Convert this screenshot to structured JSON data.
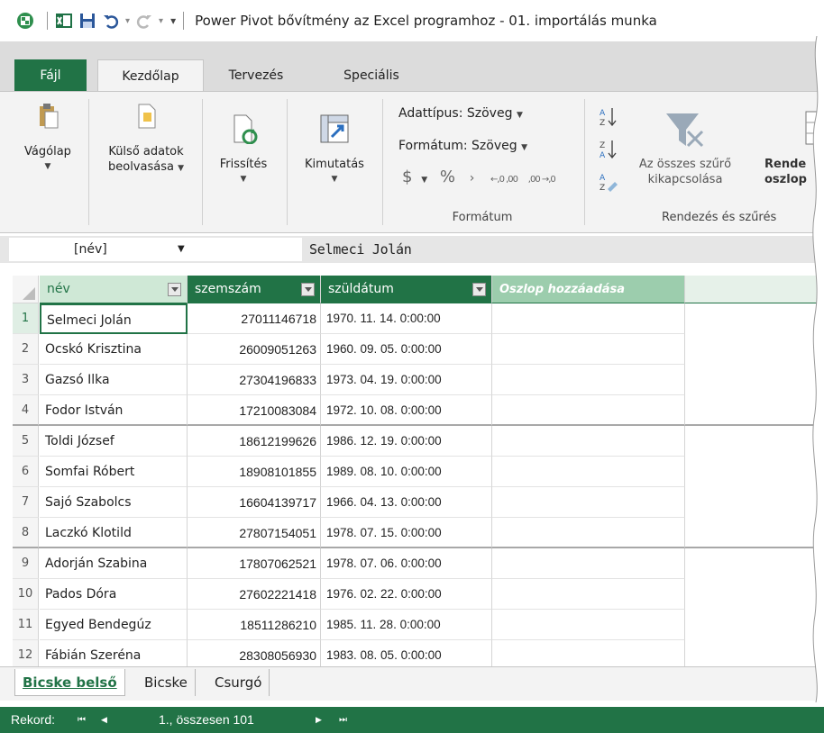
{
  "window": {
    "title": "Power Pivot bővítmény az Excel programhoz - 01. importálás munka"
  },
  "tabs": [
    {
      "label": "Fájl"
    },
    {
      "label": "Kezdőlap"
    },
    {
      "label": "Tervezés"
    },
    {
      "label": "Speciális"
    }
  ],
  "ribbon": {
    "clipboard": {
      "label": "Vágólap"
    },
    "external": {
      "line1": "Külső adatok",
      "line2": "beolvasása"
    },
    "refresh": {
      "label": "Frissítés"
    },
    "pivot": {
      "label": "Kimutatás"
    },
    "format": {
      "datatype": "Adattípus: Szöveg",
      "format": "Formátum: Szöveg",
      "currency": "$",
      "percent": "%",
      "comma": "›",
      "dec_inc": "←,0 ,00",
      "dec_dec": ",00 →,0",
      "group_label": "Formátum"
    },
    "sort": {
      "clear_line1": "Az összes szűrő",
      "clear_line2": "kikapcsolása",
      "sortcol_line1": "Rende",
      "sortcol_line2": "oszlop",
      "group_label": "Rendezés és szűrés"
    }
  },
  "formula_bar": {
    "name_box": "[név]",
    "value": "Selmeci Jolán"
  },
  "grid": {
    "columns": [
      {
        "label": "név"
      },
      {
        "label": "szemszám"
      },
      {
        "label": "szüldátum"
      },
      {
        "label": "Oszlop hozzáadása"
      }
    ],
    "rows": [
      {
        "n": "1",
        "name": "Selmeci Jolán",
        "id": "27011146718",
        "date": "1970. 11. 14. 0:00:00"
      },
      {
        "n": "2",
        "name": "Ocskó Krisztina",
        "id": "26009051263",
        "date": "1960. 09. 05. 0:00:00"
      },
      {
        "n": "3",
        "name": "Gazsó Ilka",
        "id": "27304196833",
        "date": "1973. 04. 19. 0:00:00"
      },
      {
        "n": "4",
        "name": "Fodor István",
        "id": "17210083084",
        "date": "1972. 10. 08. 0:00:00"
      },
      {
        "n": "5",
        "name": "Toldi József",
        "id": "18612199626",
        "date": "1986. 12. 19. 0:00:00"
      },
      {
        "n": "6",
        "name": "Somfai Róbert",
        "id": "18908101855",
        "date": "1989. 08. 10. 0:00:00"
      },
      {
        "n": "7",
        "name": "Sajó Szabolcs",
        "id": "16604139717",
        "date": "1966. 04. 13. 0:00:00"
      },
      {
        "n": "8",
        "name": "Laczkó Klotild",
        "id": "27807154051",
        "date": "1978. 07. 15. 0:00:00"
      },
      {
        "n": "9",
        "name": "Adorján Szabina",
        "id": "17807062521",
        "date": "1978. 07. 06. 0:00:00"
      },
      {
        "n": "10",
        "name": "Pados Dóra",
        "id": "27602221418",
        "date": "1976. 02. 22. 0:00:00"
      },
      {
        "n": "11",
        "name": "Egyed Bendegúz",
        "id": "18511286210",
        "date": "1985. 11. 28. 0:00:00"
      },
      {
        "n": "12",
        "name": "Fábián Szeréna",
        "id": "28308056930",
        "date": "1983. 08. 05. 0:00:00"
      }
    ]
  },
  "sheets": [
    {
      "label": "Bicske belső"
    },
    {
      "label": "Bicske"
    },
    {
      "label": "Csurgó"
    }
  ],
  "status": {
    "label": "Rekord:",
    "first": "⏮",
    "prev": "◀",
    "position": "1., összesen 101",
    "next": "▶",
    "last": "⏭"
  },
  "colors": {
    "accent": "#217346",
    "header_light": "#9ccdad"
  }
}
